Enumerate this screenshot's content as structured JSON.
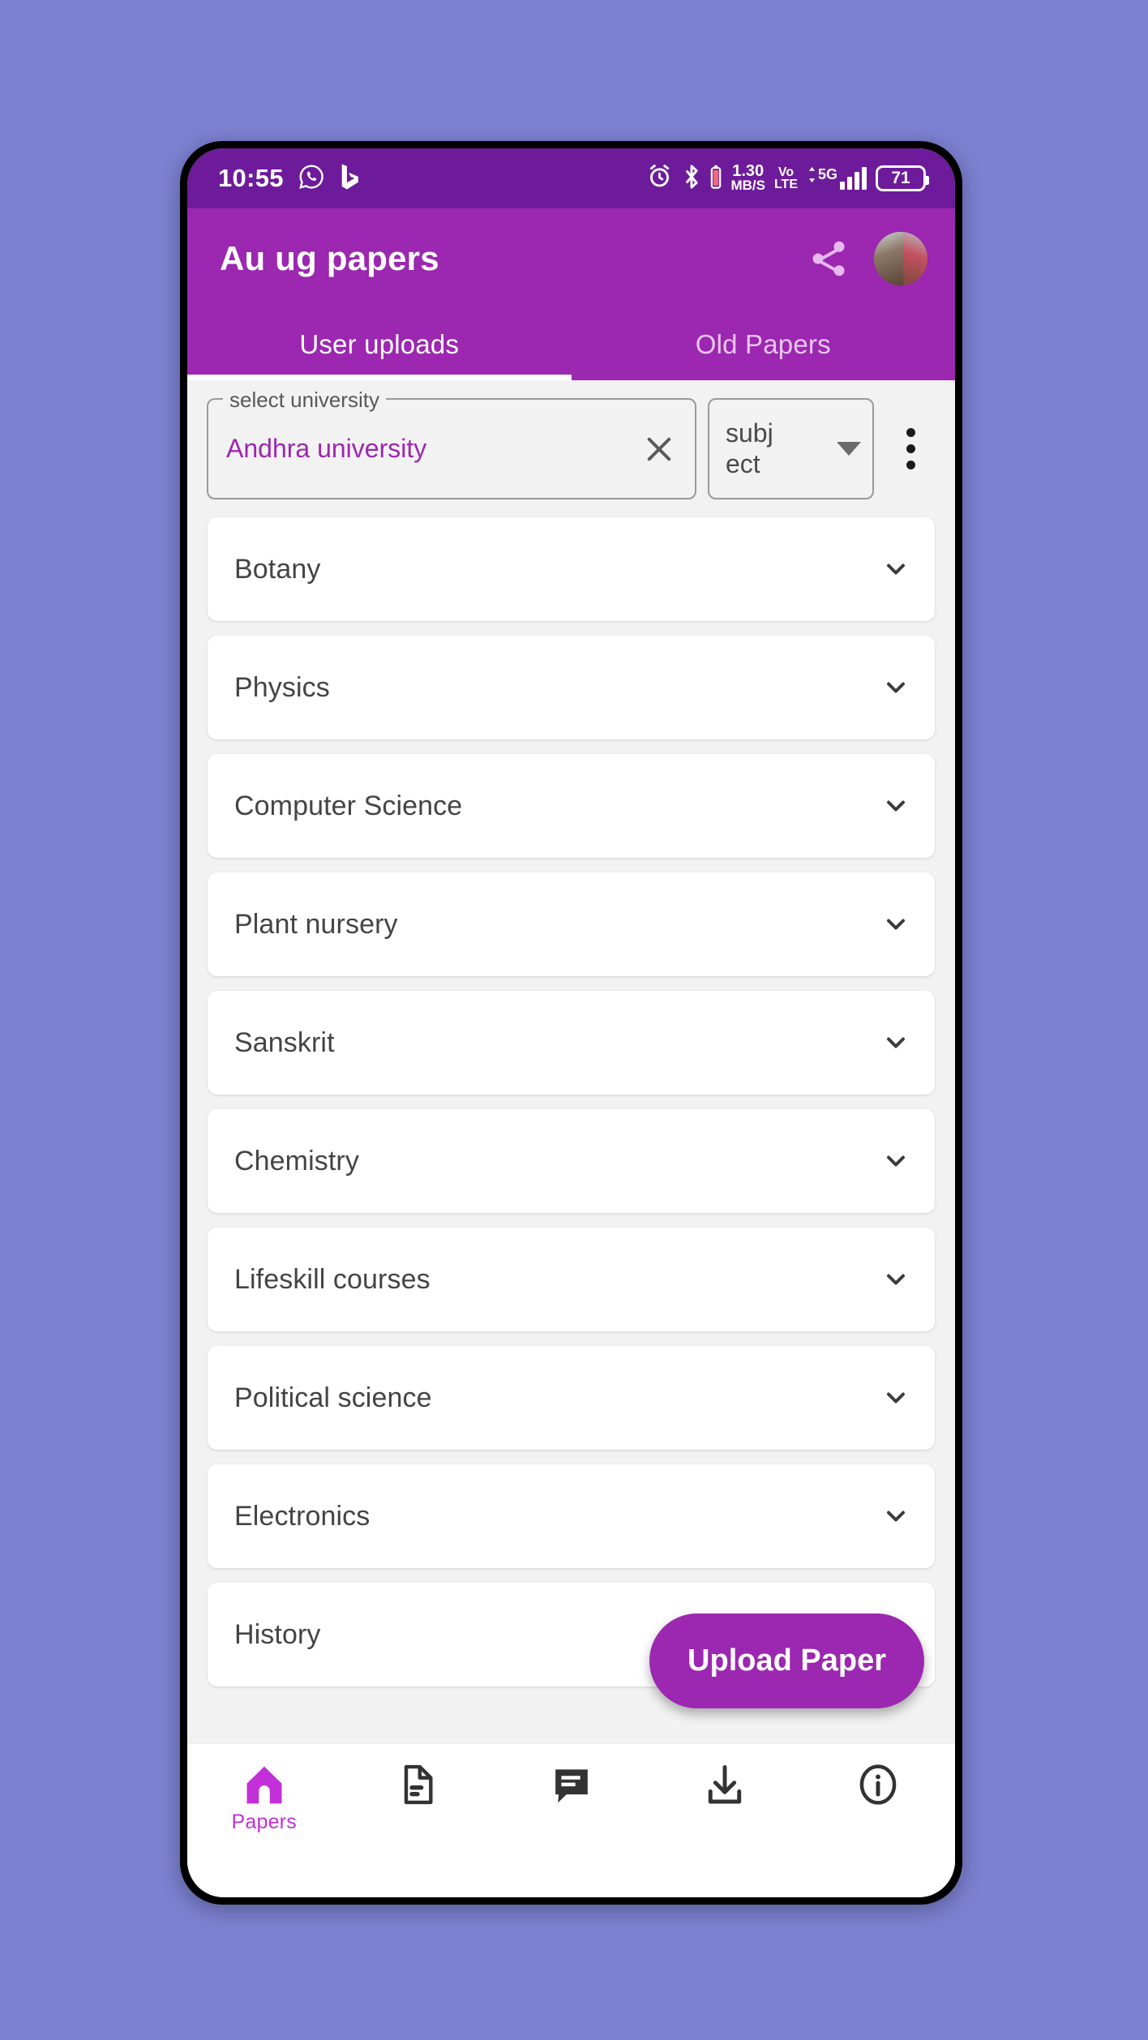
{
  "status_bar": {
    "time": "10:55",
    "left_icons": [
      "whatsapp-icon",
      "bing-icon"
    ],
    "alarm_icon": "alarm-icon",
    "bluetooth_icon": "bluetooth-icon",
    "net_speed_value": "1.30",
    "net_speed_unit": "MB/S",
    "volte_line1": "Vo",
    "volte_line2": "LTE",
    "network_type": "5G",
    "battery_percent": "71"
  },
  "app_bar": {
    "title": "Au ug papers",
    "share_icon": "share-icon",
    "avatar": "user-avatar"
  },
  "tabs": [
    {
      "label": "User uploads",
      "active": true
    },
    {
      "label": "Old Papers",
      "active": false
    }
  ],
  "filters": {
    "university": {
      "legend": "select university",
      "value": "Andhra university",
      "clear_icon": "close-icon"
    },
    "subject": {
      "value_line1": "subj",
      "value_line2": "ect",
      "caret_icon": "chevron-down-icon"
    },
    "overflow_menu_icon": "more-vertical-icon"
  },
  "subjects": [
    {
      "name": "Botany"
    },
    {
      "name": "Physics"
    },
    {
      "name": "Computer Science"
    },
    {
      "name": "Plant nursery"
    },
    {
      "name": "Sanskrit"
    },
    {
      "name": "Chemistry"
    },
    {
      "name": "Lifeskill courses"
    },
    {
      "name": "Political science"
    },
    {
      "name": "Electronics"
    },
    {
      "name": "History"
    }
  ],
  "fab": {
    "label": "Upload Paper"
  },
  "bottom_nav": [
    {
      "icon": "home-icon",
      "label": "Papers",
      "active": true
    },
    {
      "icon": "document-icon",
      "label": "",
      "active": false
    },
    {
      "icon": "chat-icon",
      "label": "",
      "active": false
    },
    {
      "icon": "download-icon",
      "label": "",
      "active": false
    },
    {
      "icon": "info-icon",
      "label": "",
      "active": false
    }
  ],
  "colors": {
    "wallpaper": "#7c81d1",
    "status_bar": "#6d1b9a",
    "app_bar": "#9c27b0",
    "accent": "#9c27b0",
    "nav_active": "#c230d8",
    "surface": "#f2f2f2",
    "card": "#ffffff"
  }
}
